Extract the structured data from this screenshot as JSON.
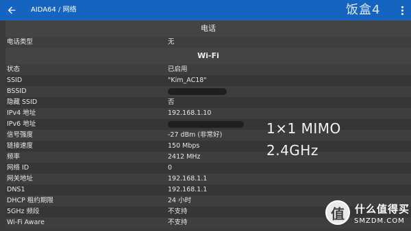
{
  "appbar": {
    "title": "AIDA64 / 网络",
    "watermark": "饭盒4"
  },
  "sections": {
    "phone": {
      "header": "电话",
      "rows": [
        {
          "label": "电话类型",
          "value": "无"
        }
      ]
    },
    "wifi": {
      "header": "Wi-Fi",
      "rows": [
        {
          "label": "状态",
          "value": "已启用"
        },
        {
          "label": "SSID",
          "value": "\"Kim_AC18\""
        },
        {
          "label": "BSSID",
          "value": ""
        },
        {
          "label": "隐藏 SSID",
          "value": "否"
        },
        {
          "label": "IPv4 地址",
          "value": "192.168.1.10"
        },
        {
          "label": "IPv6 地址",
          "value": ""
        },
        {
          "label": "信号强度",
          "value": "-27 dBm (非常好)"
        },
        {
          "label": "链接速度",
          "value": "150 Mbps"
        },
        {
          "label": "频率",
          "value": "2412 MHz"
        },
        {
          "label": "网络 ID",
          "value": "0"
        },
        {
          "label": "网关地址",
          "value": "192.168.1.1"
        },
        {
          "label": "DNS1",
          "value": "192.168.1.1"
        },
        {
          "label": "DHCP 租约期限",
          "value": "24 小时"
        },
        {
          "label": "5GHz 频段",
          "value": "不支持"
        },
        {
          "label": "Wi-Fi Aware",
          "value": "不支持"
        }
      ]
    }
  },
  "overlay": {
    "line1": "1×1 MIMO",
    "line2": "2.4GHz"
  },
  "brand": {
    "badge": "值",
    "name": "什么值得买",
    "url": "SMZDM.COM"
  },
  "icons": {
    "back": "arrow-back-icon",
    "more": "more-vert-icon"
  },
  "colors": {
    "appbar": "#1565c0",
    "background": "#3a3a3a"
  }
}
